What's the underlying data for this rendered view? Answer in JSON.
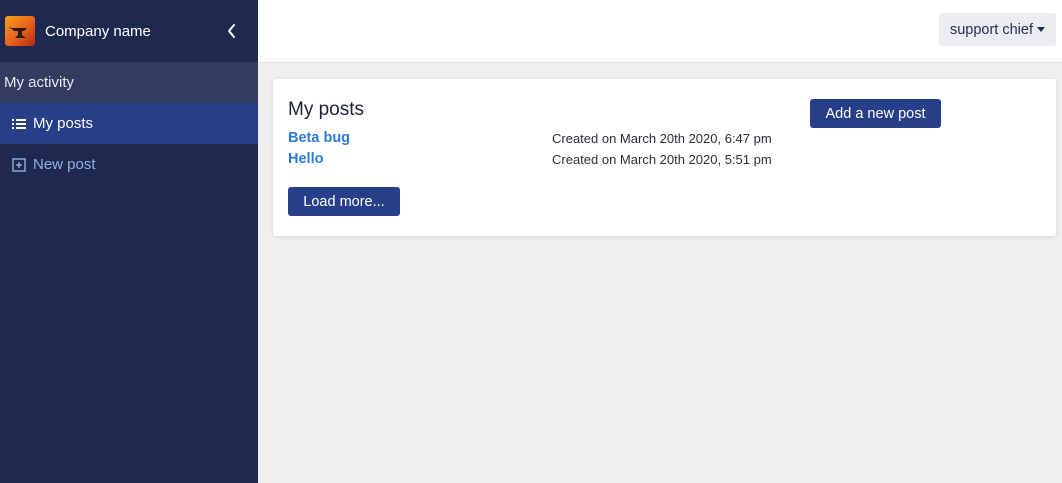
{
  "sidebar": {
    "brand": {
      "name": "Company name",
      "logo_icon": "anvil-logo-icon",
      "collapse_icon": "chevron-left-icon"
    },
    "section_label": "My activity",
    "items": [
      {
        "label": "My posts",
        "icon": "list-icon",
        "active": true
      },
      {
        "label": "New post",
        "icon": "plus-square-icon",
        "active": false
      }
    ]
  },
  "topbar": {
    "user_menu_label": "support chief"
  },
  "main": {
    "card": {
      "title": "My posts",
      "add_button_label": "Add a new post",
      "posts": [
        {
          "title": "Beta bug",
          "created": "Created on March 20th 2020, 6:47 pm"
        },
        {
          "title": "Hello",
          "created": "Created on March 20th 2020, 5:51 pm"
        }
      ],
      "load_more_label": "Load more..."
    }
  },
  "colors": {
    "sidebar_bg": "#1f294f",
    "sidebar_active": "#273f88",
    "accent_button": "#273f88",
    "link": "#2b7bd8"
  }
}
